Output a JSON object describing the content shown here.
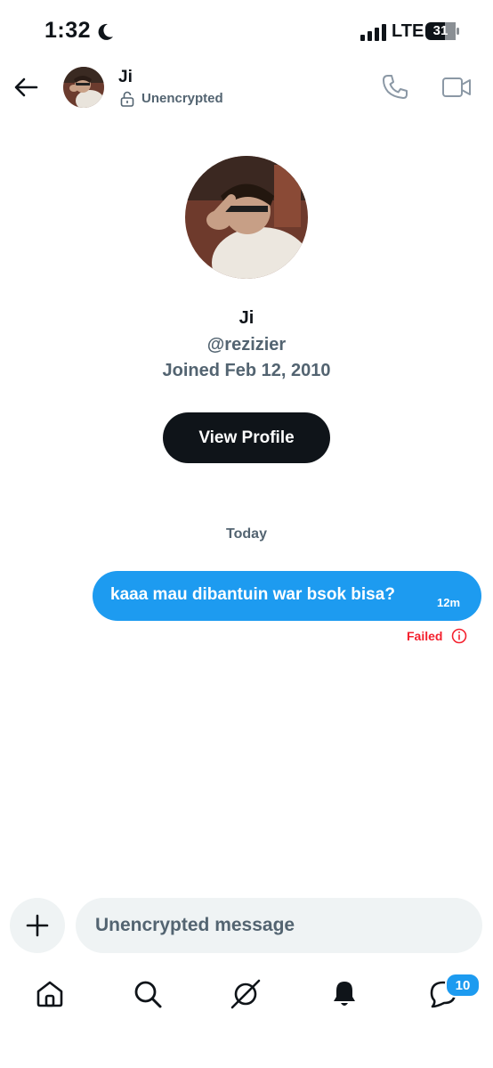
{
  "status_bar": {
    "time": "1:32",
    "network": "LTE",
    "battery": "31",
    "icons": [
      "moon-icon",
      "signal-icon",
      "battery-icon"
    ]
  },
  "header": {
    "name": "Ji",
    "encryption": "Unencrypted",
    "icons": [
      "back-arrow-icon",
      "lock-open-icon",
      "phone-icon",
      "video-icon"
    ]
  },
  "profile": {
    "name": "Ji",
    "handle": "@rezizier",
    "joined": "Joined Feb 12, 2010",
    "view_button": "View Profile"
  },
  "conversation": {
    "date_separator": "Today",
    "messages": [
      {
        "text": "kaaa mau dibantuin war bsok bisa?",
        "time": "12m",
        "status": "Failed"
      }
    ]
  },
  "composer": {
    "placeholder": "Unencrypted message"
  },
  "bottom_nav": {
    "items": [
      "home",
      "search",
      "grok",
      "notifications",
      "messages"
    ],
    "messages_badge": "10"
  },
  "colors": {
    "accent": "#1d9bf0",
    "text": "#0f1419",
    "secondary": "#536471",
    "error": "#f4212e",
    "input_bg": "#eff3f4"
  }
}
